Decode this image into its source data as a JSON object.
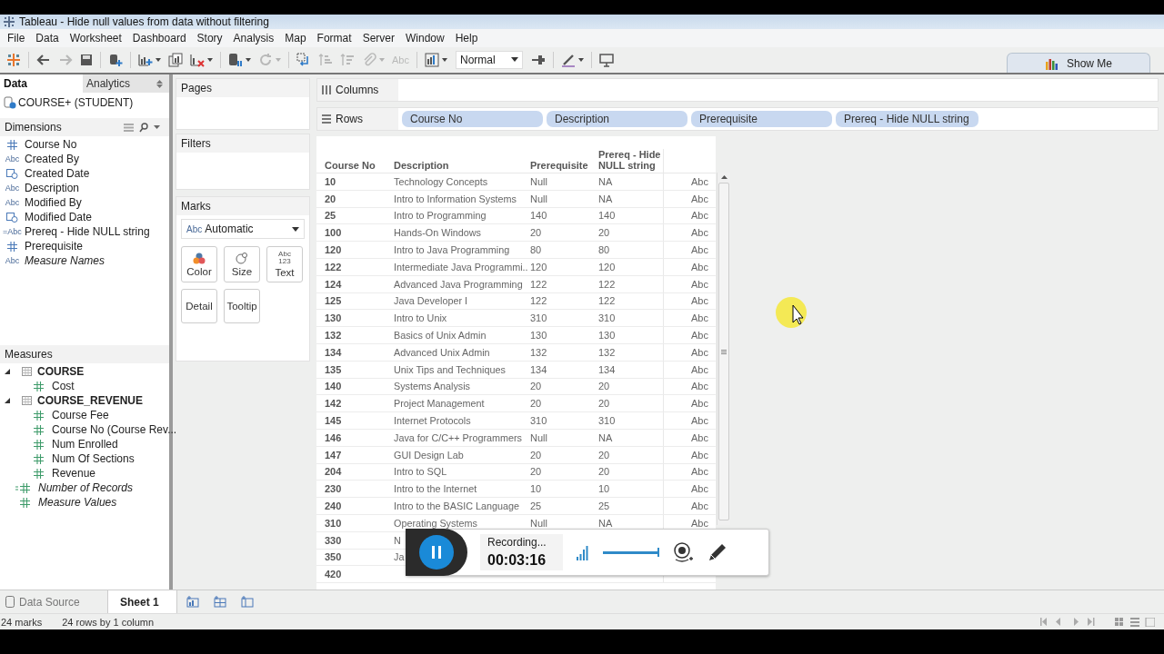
{
  "window": {
    "title": "Tableau - Hide null values from data without filtering"
  },
  "menu": [
    "File",
    "Data",
    "Worksheet",
    "Dashboard",
    "Story",
    "Analysis",
    "Map",
    "Format",
    "Server",
    "Window",
    "Help"
  ],
  "toolbar": [
    {
      "kind": "logo",
      "disabled": false,
      "dropdown": false
    },
    {
      "kind": "separator"
    },
    {
      "kind": "back",
      "disabled": false,
      "dropdown": false
    },
    {
      "kind": "forward",
      "disabled": true,
      "dropdown": false
    },
    {
      "kind": "save",
      "disabled": false,
      "dropdown": false
    },
    {
      "kind": "separator"
    },
    {
      "kind": "new-data",
      "disabled": false,
      "dropdown": false
    },
    {
      "kind": "separator"
    },
    {
      "kind": "new-sheet",
      "disabled": false,
      "dropdown": true
    },
    {
      "kind": "duplicate",
      "disabled": false,
      "dropdown": false
    },
    {
      "kind": "clear",
      "disabled": false,
      "dropdown": true
    },
    {
      "kind": "separator"
    },
    {
      "kind": "pause",
      "disabled": false,
      "dropdown": true
    },
    {
      "kind": "refresh",
      "disabled": true,
      "dropdown": true
    },
    {
      "kind": "separator"
    },
    {
      "kind": "swap",
      "disabled": false,
      "dropdown": false
    },
    {
      "kind": "sort-asc",
      "disabled": true,
      "dropdown": false
    },
    {
      "kind": "sort-desc",
      "disabled": true,
      "dropdown": false
    },
    {
      "kind": "clip",
      "disabled": true,
      "dropdown": true
    },
    {
      "kind": "label",
      "text": "Abc",
      "disabled": true,
      "dropdown": false
    },
    {
      "kind": "separator"
    },
    {
      "kind": "chart",
      "disabled": false,
      "dropdown": true
    },
    {
      "kind": "select",
      "value": "Normal"
    },
    {
      "kind": "pin",
      "disabled": false,
      "dropdown": false
    },
    {
      "kind": "separator"
    },
    {
      "kind": "pen",
      "disabled": false,
      "dropdown": true
    },
    {
      "kind": "separator"
    },
    {
      "kind": "present",
      "disabled": false,
      "dropdown": false
    }
  ],
  "show_me": "Show Me",
  "side_tabs": [
    {
      "label": "Data",
      "selected": true
    },
    {
      "label": "Analytics",
      "selected": false
    }
  ],
  "data_source": "COURSE+ (STUDENT)",
  "dimensions": {
    "title": "Dimensions",
    "items": [
      {
        "kind": "number",
        "label": "Course No",
        "italic": false
      },
      {
        "kind": "string",
        "glyph": "Abc",
        "label": "Created By",
        "italic": false
      },
      {
        "kind": "date",
        "label": "Created Date",
        "italic": false
      },
      {
        "kind": "string",
        "glyph": "Abc",
        "label": "Description",
        "italic": false
      },
      {
        "kind": "string",
        "glyph": "Abc",
        "label": "Modified By",
        "italic": false
      },
      {
        "kind": "date",
        "label": "Modified Date",
        "italic": false
      },
      {
        "kind": "string",
        "glyph": "=Abc",
        "label": "Prereq - Hide NULL string",
        "italic": false
      },
      {
        "kind": "number",
        "label": "Prerequisite",
        "italic": false
      },
      {
        "kind": "string",
        "glyph": "Abc",
        "label": "Measure Names",
        "italic": true
      }
    ]
  },
  "measures": {
    "title": "Measures",
    "items": [
      {
        "kind": "table",
        "label": "COURSE",
        "expanded": true,
        "children": [
          {
            "kind": "number",
            "label": "Cost",
            "italic": false
          }
        ]
      },
      {
        "kind": "table",
        "label": "COURSE_REVENUE",
        "expanded": true,
        "children": [
          {
            "kind": "number",
            "label": "Course Fee",
            "italic": false
          },
          {
            "kind": "number",
            "label": "Course No (Course Rev...",
            "italic": false
          },
          {
            "kind": "number",
            "label": "Num Enrolled",
            "italic": false
          },
          {
            "kind": "number",
            "label": "Num Of Sections",
            "italic": false
          },
          {
            "kind": "number",
            "label": "Revenue",
            "italic": false
          }
        ]
      },
      {
        "kind": "calc_number",
        "label": "Number of Records",
        "italic": true
      },
      {
        "kind": "number",
        "label": "Measure Values",
        "italic": true
      }
    ]
  },
  "cards": {
    "pages": "Pages",
    "filters": "Filters",
    "marks": "Marks"
  },
  "marks": {
    "type_glyph": "Abc",
    "type": "Automatic",
    "buttons": [
      {
        "kind": "color",
        "label": "Color"
      },
      {
        "kind": "size",
        "label": "Size"
      },
      {
        "kind": "text",
        "label": "Text",
        "icon_text": "Abc 123"
      },
      {
        "kind": "detail",
        "label": "Detail"
      },
      {
        "kind": "tooltip",
        "label": "Tooltip"
      }
    ]
  },
  "shelves": [
    {
      "kind": "columns",
      "label": "Columns"
    },
    {
      "kind": "rows",
      "label": "Rows",
      "pills": [
        "Course No",
        "Description",
        "Prerequisite",
        "Prereq - Hide NULL string"
      ]
    }
  ],
  "table": {
    "columns": [
      "Course No",
      "Description",
      "Prerequisite",
      "Prereq - Hide NULL string"
    ],
    "rows": [
      {
        "course_no": "10",
        "description": "Technology Concepts",
        "prerequisite": "Null",
        "prereq_hide": "NA",
        "mark": "Abc"
      },
      {
        "course_no": "20",
        "description": "Intro to Information Systems",
        "prerequisite": "Null",
        "prereq_hide": "NA",
        "mark": "Abc"
      },
      {
        "course_no": "25",
        "description": "Intro to Programming",
        "prerequisite": "140",
        "prereq_hide": "140",
        "mark": "Abc"
      },
      {
        "course_no": "100",
        "description": "Hands-On Windows",
        "prerequisite": "20",
        "prereq_hide": "20",
        "mark": "Abc"
      },
      {
        "course_no": "120",
        "description": "Intro to Java Programming",
        "prerequisite": "80",
        "prereq_hide": "80",
        "mark": "Abc"
      },
      {
        "course_no": "122",
        "description": "Intermediate Java Programmi..",
        "prerequisite": "120",
        "prereq_hide": "120",
        "mark": "Abc"
      },
      {
        "course_no": "124",
        "description": "Advanced Java Programming",
        "prerequisite": "122",
        "prereq_hide": "122",
        "mark": "Abc"
      },
      {
        "course_no": "125",
        "description": "Java Developer I",
        "prerequisite": "122",
        "prereq_hide": "122",
        "mark": "Abc"
      },
      {
        "course_no": "130",
        "description": "Intro to Unix",
        "prerequisite": "310",
        "prereq_hide": "310",
        "mark": "Abc"
      },
      {
        "course_no": "132",
        "description": "Basics of Unix Admin",
        "prerequisite": "130",
        "prereq_hide": "130",
        "mark": "Abc"
      },
      {
        "course_no": "134",
        "description": "Advanced Unix Admin",
        "prerequisite": "132",
        "prereq_hide": "132",
        "mark": "Abc"
      },
      {
        "course_no": "135",
        "description": "Unix Tips and Techniques",
        "prerequisite": "134",
        "prereq_hide": "134",
        "mark": "Abc"
      },
      {
        "course_no": "140",
        "description": "Systems Analysis",
        "prerequisite": "20",
        "prereq_hide": "20",
        "mark": "Abc"
      },
      {
        "course_no": "142",
        "description": "Project Management",
        "prerequisite": "20",
        "prereq_hide": "20",
        "mark": "Abc"
      },
      {
        "course_no": "145",
        "description": "Internet Protocols",
        "prerequisite": "310",
        "prereq_hide": "310",
        "mark": "Abc"
      },
      {
        "course_no": "146",
        "description": "Java for C/C++ Programmers",
        "prerequisite": "Null",
        "prereq_hide": "NA",
        "mark": "Abc"
      },
      {
        "course_no": "147",
        "description": "GUI Design Lab",
        "prerequisite": "20",
        "prereq_hide": "20",
        "mark": "Abc"
      },
      {
        "course_no": "204",
        "description": "Intro to SQL",
        "prerequisite": "20",
        "prereq_hide": "20",
        "mark": "Abc"
      },
      {
        "course_no": "230",
        "description": "Intro to the Internet",
        "prerequisite": "10",
        "prereq_hide": "10",
        "mark": "Abc"
      },
      {
        "course_no": "240",
        "description": "Intro to the BASIC Language",
        "prerequisite": "25",
        "prereq_hide": "25",
        "mark": "Abc"
      },
      {
        "course_no": "310",
        "description": "Operating Systems",
        "prerequisite": "Null",
        "prereq_hide": "NA",
        "mark": "Abc"
      },
      {
        "course_no": "330",
        "description": "N"
      },
      {
        "course_no": "350",
        "description": "Ja"
      },
      {
        "course_no": "420"
      }
    ]
  },
  "sheet_tabs": [
    {
      "kind": "data_source",
      "label": "Data Source",
      "selected": false
    },
    {
      "kind": "sheet",
      "label": "Sheet 1",
      "selected": true
    }
  ],
  "status_bar": [
    "24 marks",
    "24 rows by 1 column"
  ],
  "recorder": {
    "status": "Recording...",
    "time": "00:03:16",
    "volume": {
      "level": 1.0
    }
  }
}
